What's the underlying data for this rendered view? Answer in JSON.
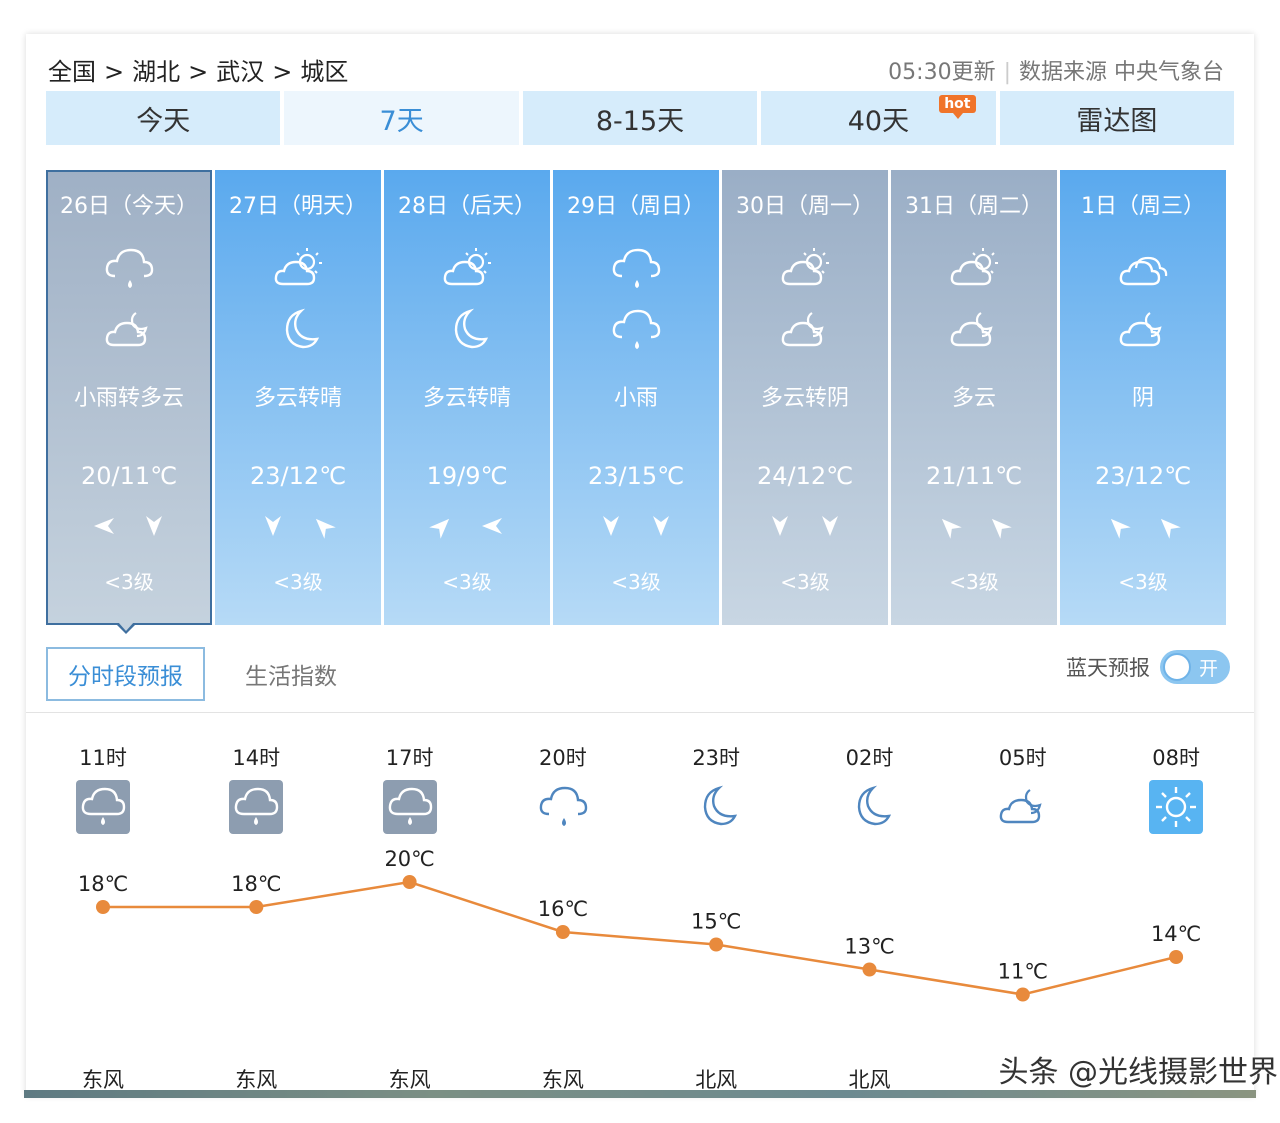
{
  "breadcrumb": [
    "全国",
    "湖北",
    "武汉",
    "城区"
  ],
  "breadcrumb_sep": ">",
  "update": {
    "time": "05:30更新",
    "source": "数据来源 中央气象台"
  },
  "tabs": [
    {
      "label": "今天"
    },
    {
      "label": "7天",
      "active": true
    },
    {
      "label": "8-15天"
    },
    {
      "label": "40天",
      "badge": "hot"
    },
    {
      "label": "雷达图"
    }
  ],
  "days": [
    {
      "date": "26日（今天）",
      "icon_day": "rain-cloud-icon",
      "icon_night": "cloudy-night-icon",
      "desc": "小雨转多云",
      "temp": "20/11℃",
      "wind_dirs": [
        "left",
        "down"
      ],
      "level": "<3级",
      "style": "sel"
    },
    {
      "date": "27日（明天）",
      "icon_day": "partly-cloudy-icon",
      "icon_night": "moon-icon",
      "desc": "多云转晴",
      "temp": "23/12℃",
      "wind_dirs": [
        "down",
        "up-left"
      ],
      "level": "<3级",
      "style": "blue"
    },
    {
      "date": "28日（后天）",
      "icon_day": "partly-cloudy-icon",
      "icon_night": "moon-icon",
      "desc": "多云转晴",
      "temp": "19/9℃",
      "wind_dirs": [
        "up-right",
        "left"
      ],
      "level": "<3级",
      "style": "blue"
    },
    {
      "date": "29日（周日）",
      "icon_day": "rain-cloud-icon",
      "icon_night": "rain-cloud-icon",
      "desc": "小雨",
      "temp": "23/15℃",
      "wind_dirs": [
        "down",
        "down"
      ],
      "level": "<3级",
      "style": "blue"
    },
    {
      "date": "30日（周一）",
      "icon_day": "partly-cloudy-icon",
      "icon_night": "cloudy-night-icon",
      "desc": "多云转阴",
      "temp": "24/12℃",
      "wind_dirs": [
        "down",
        "down"
      ],
      "level": "<3级",
      "style": "grey"
    },
    {
      "date": "31日（周二）",
      "icon_day": "partly-cloudy-icon",
      "icon_night": "cloudy-night-icon",
      "desc": "多云",
      "temp": "21/11℃",
      "wind_dirs": [
        "up-left",
        "up-left"
      ],
      "level": "<3级",
      "style": "grey"
    },
    {
      "date": "1日（周三）",
      "icon_day": "overcast-icon",
      "icon_night": "cloudy-night-icon",
      "desc": "阴",
      "temp": "23/12℃",
      "wind_dirs": [
        "up-left",
        "up-left"
      ],
      "level": "<3级",
      "style": "blue"
    }
  ],
  "subtabs": [
    {
      "label": "分时段预报",
      "active": true
    },
    {
      "label": "生活指数"
    }
  ],
  "bluesky": {
    "label": "蓝天预报",
    "toggle": "开"
  },
  "hourly": [
    {
      "time": "11时",
      "icon": "rain-box-icon",
      "temp": "18℃",
      "wind": "东风"
    },
    {
      "time": "14时",
      "icon": "rain-box-icon",
      "temp": "18℃",
      "wind": "东风"
    },
    {
      "time": "17时",
      "icon": "rain-box-icon",
      "temp": "20℃",
      "wind": "东风"
    },
    {
      "time": "20时",
      "icon": "rain-cloud-outline-icon",
      "temp": "16℃",
      "wind": "东风"
    },
    {
      "time": "23时",
      "icon": "moon-outline-icon",
      "temp": "15℃",
      "wind": "北风"
    },
    {
      "time": "02时",
      "icon": "moon-outline-icon",
      "temp": "13℃",
      "wind": "北风"
    },
    {
      "time": "05时",
      "icon": "cloudy-night-outline-icon",
      "temp": "11℃",
      "wind": ""
    },
    {
      "time": "08时",
      "icon": "sun-box-icon",
      "temp": "14℃",
      "wind": ""
    }
  ],
  "chart_data": {
    "type": "line",
    "categories": [
      "11时",
      "14时",
      "17时",
      "20时",
      "23时",
      "02时",
      "05时",
      "08时"
    ],
    "series": [
      {
        "values": [
          18,
          18,
          20,
          16,
          15,
          13,
          11,
          14
        ]
      }
    ],
    "ylim": [
      8,
      24
    ],
    "line_color": "#e88a3c"
  },
  "watermark": "头条 @光线摄影世界",
  "colors": {
    "accent": "#3a8ed6",
    "card_blue": "#5aa9ee",
    "card_grey": "#9aaec6",
    "line": "#e88a3c",
    "hot": "#f0742a"
  }
}
